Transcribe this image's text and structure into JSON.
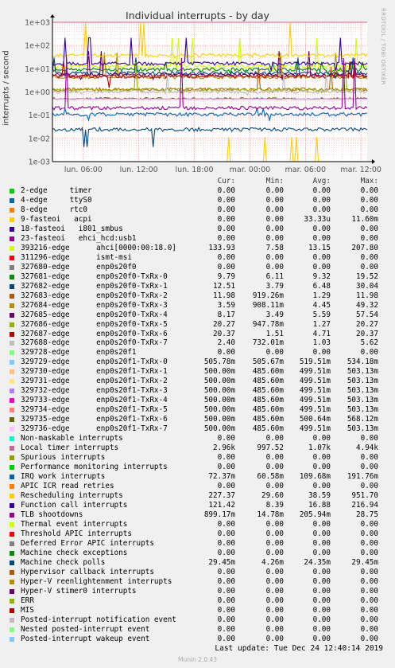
{
  "title": "Individual interrupts - by day",
  "ylabel": "interrupts / second",
  "watermark": "RRDTOOL / TOBI OETIKER",
  "footer": {
    "last_update": "Last update:  Tue Dec 24 12:40:14 2019",
    "munin": "Munin 2.0.43"
  },
  "columns": [
    "Cur:",
    "Min:",
    "Avg:",
    "Max:"
  ],
  "chart_data": {
    "type": "line",
    "title": "Individual interrupts - by day",
    "ylabel": "interrupts / second",
    "yscale": "log",
    "ylim": [
      0.001,
      1000
    ],
    "yticks": [
      "1e+03",
      "1e+02",
      "1e+01",
      "1e+00",
      "1e-01",
      "1e-02",
      "1e-03"
    ],
    "xticks": [
      "lun. 06:00",
      "lun. 12:00",
      "lun. 18:00",
      "mar. 00:00",
      "mar. 06:00",
      "mar. 12:00"
    ],
    "xrange_hours": [
      2.67,
      36.67
    ],
    "grid": true,
    "legend_position": "bottom",
    "series": [
      {
        "name": "2-edge     timer",
        "color": "#00cc00",
        "cur": "0.00",
        "min": "0.00",
        "avg": "0.00",
        "max": "0.00"
      },
      {
        "name": "4-edge     ttyS0",
        "color": "#0066b3",
        "cur": "0.00",
        "min": "0.00",
        "avg": "0.00",
        "max": "0.00"
      },
      {
        "name": "8-edge     rtc0",
        "color": "#ff8000",
        "cur": "0.00",
        "min": "0.00",
        "avg": "0.00",
        "max": "0.00"
      },
      {
        "name": "9-fasteoi   acpi",
        "color": "#ffcc00",
        "cur": "0.00",
        "min": "0.00",
        "avg": "33.33u",
        "max": "11.60m"
      },
      {
        "name": "18-fasteoi   i801_smbus",
        "color": "#330099",
        "cur": "0.00",
        "min": "0.00",
        "avg": "0.00",
        "max": "0.00"
      },
      {
        "name": "23-fasteoi   ehci_hcd:usb1",
        "color": "#990099",
        "cur": "0.00",
        "min": "0.00",
        "avg": "0.00",
        "max": "0.00"
      },
      {
        "name": "393216-edge      ahci[0000:00:18.0]",
        "color": "#ccff00",
        "cur": "133.93",
        "min": "7.58",
        "avg": "13.15",
        "max": "207.80"
      },
      {
        "name": "311296-edge      ismt-msi",
        "color": "#ff0000",
        "cur": "0.00",
        "min": "0.00",
        "avg": "0.00",
        "max": "0.00"
      },
      {
        "name": "327680-edge      enp0s20f0",
        "color": "#808080",
        "cur": "0.00",
        "min": "0.00",
        "avg": "0.00",
        "max": "0.00"
      },
      {
        "name": "327681-edge      enp0s20f0-TxRx-0",
        "color": "#008f00",
        "cur": "9.79",
        "min": "6.11",
        "avg": "9.32",
        "max": "19.52"
      },
      {
        "name": "327682-edge      enp0s20f0-TxRx-1",
        "color": "#00487d",
        "cur": "12.51",
        "min": "3.79",
        "avg": "6.48",
        "max": "30.04"
      },
      {
        "name": "327683-edge      enp0s20f0-TxRx-2",
        "color": "#b35a00",
        "cur": "11.98",
        "min": "919.26m",
        "avg": "1.29",
        "max": "11.98"
      },
      {
        "name": "327684-edge      enp0s20f0-TxRx-3",
        "color": "#b38f00",
        "cur": "3.59",
        "min": "908.11m",
        "avg": "4.45",
        "max": "49.32"
      },
      {
        "name": "327685-edge      enp0s20f0-TxRx-4",
        "color": "#6b006b",
        "cur": "8.17",
        "min": "3.49",
        "avg": "5.59",
        "max": "57.54"
      },
      {
        "name": "327686-edge      enp0s20f0-TxRx-5",
        "color": "#8fb300",
        "cur": "20.27",
        "min": "947.78m",
        "avg": "1.27",
        "max": "20.27"
      },
      {
        "name": "327687-edge      enp0s20f0-TxRx-6",
        "color": "#b30000",
        "cur": "20.37",
        "min": "1.51",
        "avg": "4.71",
        "max": "20.37"
      },
      {
        "name": "327688-edge      enp0s20f0-TxRx-7",
        "color": "#bebebe",
        "cur": "2.40",
        "min": "732.01m",
        "avg": "1.03",
        "max": "5.62"
      },
      {
        "name": "329728-edge      enp0s20f1",
        "color": "#80ff80",
        "cur": "0.00",
        "min": "0.00",
        "avg": "0.00",
        "max": "0.00"
      },
      {
        "name": "329729-edge      enp0s20f1-TxRx-0",
        "color": "#80c9ff",
        "cur": "505.78m",
        "min": "505.67m",
        "avg": "519.51m",
        "max": "534.18m"
      },
      {
        "name": "329730-edge      enp0s20f1-TxRx-1",
        "color": "#ffc080",
        "cur": "500.00m",
        "min": "485.60m",
        "avg": "499.51m",
        "max": "503.13m"
      },
      {
        "name": "329731-edge      enp0s20f1-TxRx-2",
        "color": "#ffe680",
        "cur": "500.00m",
        "min": "485.60m",
        "avg": "499.51m",
        "max": "503.13m"
      },
      {
        "name": "329732-edge      enp0s20f1-TxRx-3",
        "color": "#aa80ff",
        "cur": "500.00m",
        "min": "485.60m",
        "avg": "499.51m",
        "max": "503.13m"
      },
      {
        "name": "329733-edge      enp0s20f1-TxRx-4",
        "color": "#ee00cc",
        "cur": "500.00m",
        "min": "485.60m",
        "avg": "499.51m",
        "max": "503.13m"
      },
      {
        "name": "329734-edge      enp0s20f1-TxRx-5",
        "color": "#ff8080",
        "cur": "500.00m",
        "min": "485.60m",
        "avg": "499.51m",
        "max": "503.13m"
      },
      {
        "name": "329735-edge      enp0s20f1-TxRx-6",
        "color": "#666600",
        "cur": "500.00m",
        "min": "485.60m",
        "avg": "500.64m",
        "max": "568.12m"
      },
      {
        "name": "329736-edge      enp0s20f1-TxRx-7",
        "color": "#ffbfff",
        "cur": "500.00m",
        "min": "485.60m",
        "avg": "499.51m",
        "max": "503.13m"
      },
      {
        "name": "Non-maskable interrupts",
        "color": "#00ffcc",
        "cur": "0.00",
        "min": "0.00",
        "avg": "0.00",
        "max": "0.00"
      },
      {
        "name": "Local timer interrupts",
        "color": "#cc6699",
        "cur": "2.96k",
        "min": "997.52",
        "avg": "1.07k",
        "max": "4.94k"
      },
      {
        "name": "Spurious interrupts",
        "color": "#999900",
        "cur": "0.00",
        "min": "0.00",
        "avg": "0.00",
        "max": "0.00"
      },
      {
        "name": "Performance monitoring interrupts",
        "color": "#00cc00",
        "cur": "0.00",
        "min": "0.00",
        "avg": "0.00",
        "max": "0.00"
      },
      {
        "name": "IRQ work interrupts",
        "color": "#0066b3",
        "cur": "72.37m",
        "min": "60.58m",
        "avg": "109.68m",
        "max": "191.76m"
      },
      {
        "name": "APIC ICR read retries",
        "color": "#ff8000",
        "cur": "0.00",
        "min": "0.00",
        "avg": "0.00",
        "max": "0.00"
      },
      {
        "name": "Rescheduling interrupts",
        "color": "#ffcc00",
        "cur": "227.37",
        "min": "29.60",
        "avg": "38.59",
        "max": "951.70"
      },
      {
        "name": "Function call interrupts",
        "color": "#330099",
        "cur": "121.42",
        "min": "8.39",
        "avg": "16.88",
        "max": "216.94"
      },
      {
        "name": "TLB shootdowns",
        "color": "#990099",
        "cur": "899.17m",
        "min": "14.78m",
        "avg": "205.94m",
        "max": "28.75"
      },
      {
        "name": "Thermal event interrupts",
        "color": "#ccff00",
        "cur": "0.00",
        "min": "0.00",
        "avg": "0.00",
        "max": "0.00"
      },
      {
        "name": "Threshold APIC interrupts",
        "color": "#ff0000",
        "cur": "0.00",
        "min": "0.00",
        "avg": "0.00",
        "max": "0.00"
      },
      {
        "name": "Deferred Error APIC interrupts",
        "color": "#808080",
        "cur": "0.00",
        "min": "0.00",
        "avg": "0.00",
        "max": "0.00"
      },
      {
        "name": "Machine check exceptions",
        "color": "#008f00",
        "cur": "0.00",
        "min": "0.00",
        "avg": "0.00",
        "max": "0.00"
      },
      {
        "name": "Machine check polls",
        "color": "#00487d",
        "cur": "29.45m",
        "min": "4.26m",
        "avg": "24.35m",
        "max": "29.45m"
      },
      {
        "name": "Hypervisor callback interrupts",
        "color": "#b35a00",
        "cur": "0.00",
        "min": "0.00",
        "avg": "0.00",
        "max": "0.00"
      },
      {
        "name": "Hyper-V reenlightenment interrupts",
        "color": "#b38f00",
        "cur": "0.00",
        "min": "0.00",
        "avg": "0.00",
        "max": "0.00"
      },
      {
        "name": "Hyper-V stimer0 interrupts",
        "color": "#6b006b",
        "cur": "0.00",
        "min": "0.00",
        "avg": "0.00",
        "max": "0.00"
      },
      {
        "name": "ERR",
        "color": "#8fb300",
        "cur": "0.00",
        "min": "0.00",
        "avg": "0.00",
        "max": "0.00"
      },
      {
        "name": "MIS",
        "color": "#b30000",
        "cur": "0.00",
        "min": "0.00",
        "avg": "0.00",
        "max": "0.00"
      },
      {
        "name": "Posted-interrupt notification event",
        "color": "#bebebe",
        "cur": "0.00",
        "min": "0.00",
        "avg": "0.00",
        "max": "0.00"
      },
      {
        "name": "Nested posted-interrupt event",
        "color": "#80ff80",
        "cur": "0.00",
        "min": "0.00",
        "avg": "0.00",
        "max": "0.00"
      },
      {
        "name": "Posted-interrupt wakeup event",
        "color": "#80c9ff",
        "cur": "0.00",
        "min": "0.00",
        "avg": "0.00",
        "max": "0.00"
      }
    ]
  }
}
